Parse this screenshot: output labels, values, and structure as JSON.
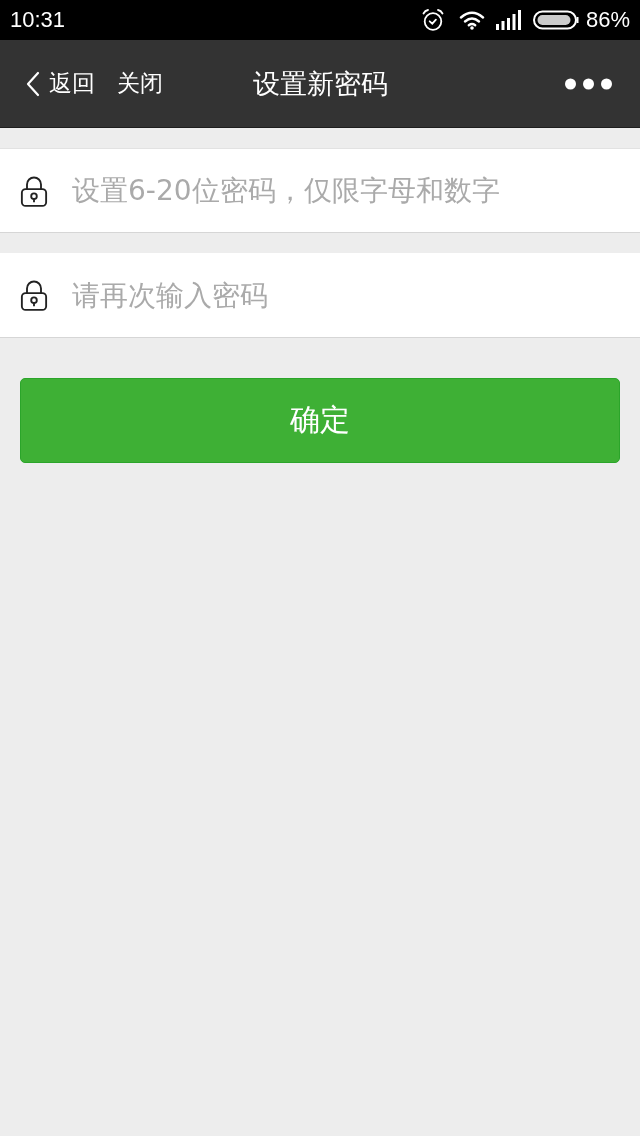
{
  "status_bar": {
    "time": "10:31",
    "battery": "86%"
  },
  "nav_bar": {
    "back": "返回",
    "close": "关闭",
    "title": "设置新密码"
  },
  "fields": [
    {
      "placeholder": "设置6-20位密码，仅限字母和数字"
    },
    {
      "placeholder": "请再次输入密码"
    }
  ],
  "confirm_button": "确定"
}
